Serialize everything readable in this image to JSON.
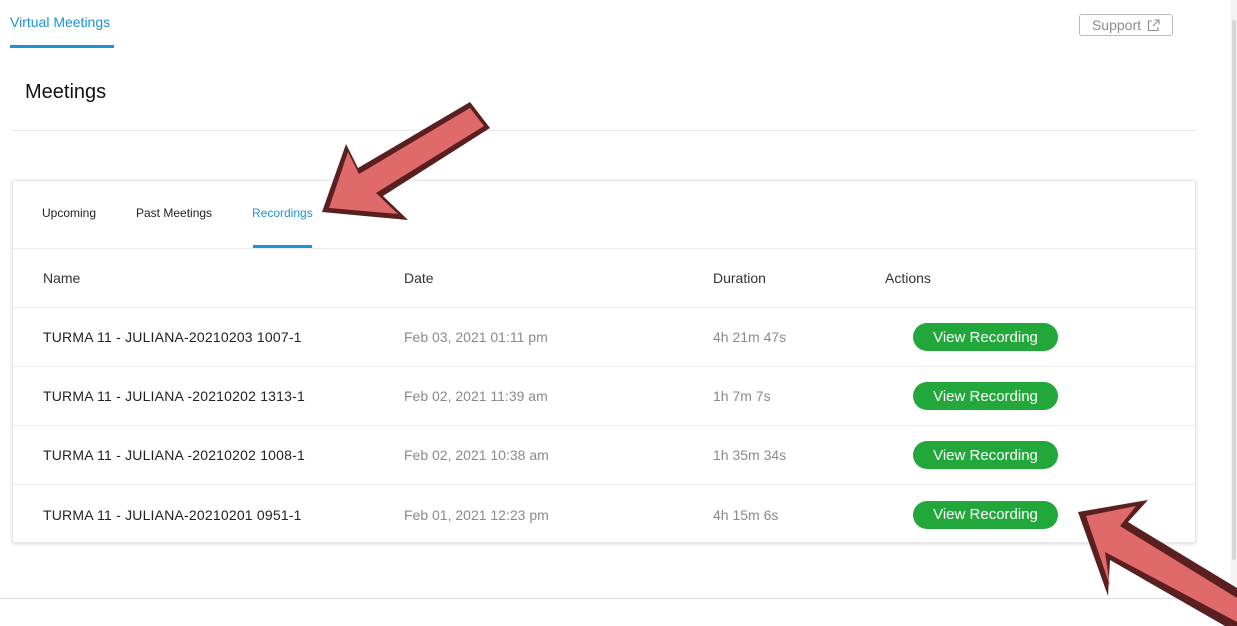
{
  "header": {
    "nav_tab": "Virtual Meetings",
    "support_label": "Support"
  },
  "page": {
    "title": "Meetings"
  },
  "tabs": [
    "Upcoming",
    "Past Meetings",
    "Recordings"
  ],
  "active_tab": "Recordings",
  "table": {
    "columns": [
      "Name",
      "Date",
      "Duration",
      "Actions"
    ],
    "rows": [
      {
        "name": "TURMA 11 - JULIANA-20210203 1007-1",
        "date": "Feb 03, 2021 01:11 pm",
        "duration": "4h 21m 47s",
        "action": "View Recording"
      },
      {
        "name": "TURMA 11 - JULIANA -20210202 1313-1",
        "date": "Feb 02, 2021 11:39 am",
        "duration": "1h 7m 7s",
        "action": "View Recording"
      },
      {
        "name": "TURMA 11 - JULIANA -20210202 1008-1",
        "date": "Feb 02, 2021 10:38 am",
        "duration": "1h 35m 34s",
        "action": "View Recording"
      },
      {
        "name": "TURMA 11 - JULIANA-20210201 0951-1",
        "date": "Feb 01, 2021 12:23 pm",
        "duration": "4h 15m 6s",
        "action": "View Recording"
      }
    ]
  },
  "colors": {
    "accent": "#1a94d6",
    "button_green": "#22a83a",
    "arrow_fill": "#e06a6a",
    "arrow_outline": "#5a1f1f"
  },
  "icons": {
    "support": "external-link-icon",
    "annotation": "arrow-pointer-icon"
  }
}
